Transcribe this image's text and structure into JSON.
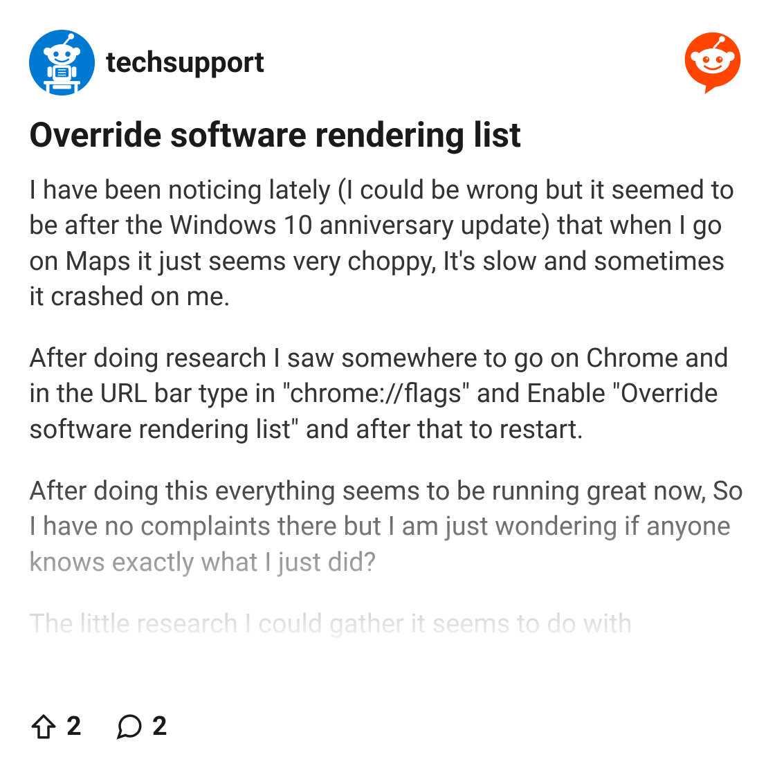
{
  "subreddit": {
    "name": "techsupport"
  },
  "post": {
    "title": "Override software rendering list",
    "paragraphs": [
      "I have been noticing lately (I could be wrong but it seemed to be after the Windows 10 anniversary update) that when I go on Maps it just seems very choppy, It's slow and sometimes it crashed on me.",
      "After doing research I saw somewhere to go on Chrome and in the URL bar type in \"chrome://flags\" and Enable \"Override software rendering list\" and after that to restart.",
      "After doing this everything seems to be running great now, So I have no complaints there but I am just wondering if anyone knows exactly what I just did?",
      "The little research I could gather it seems to do with"
    ]
  },
  "footer": {
    "upvotes": "2",
    "comments": "2"
  }
}
